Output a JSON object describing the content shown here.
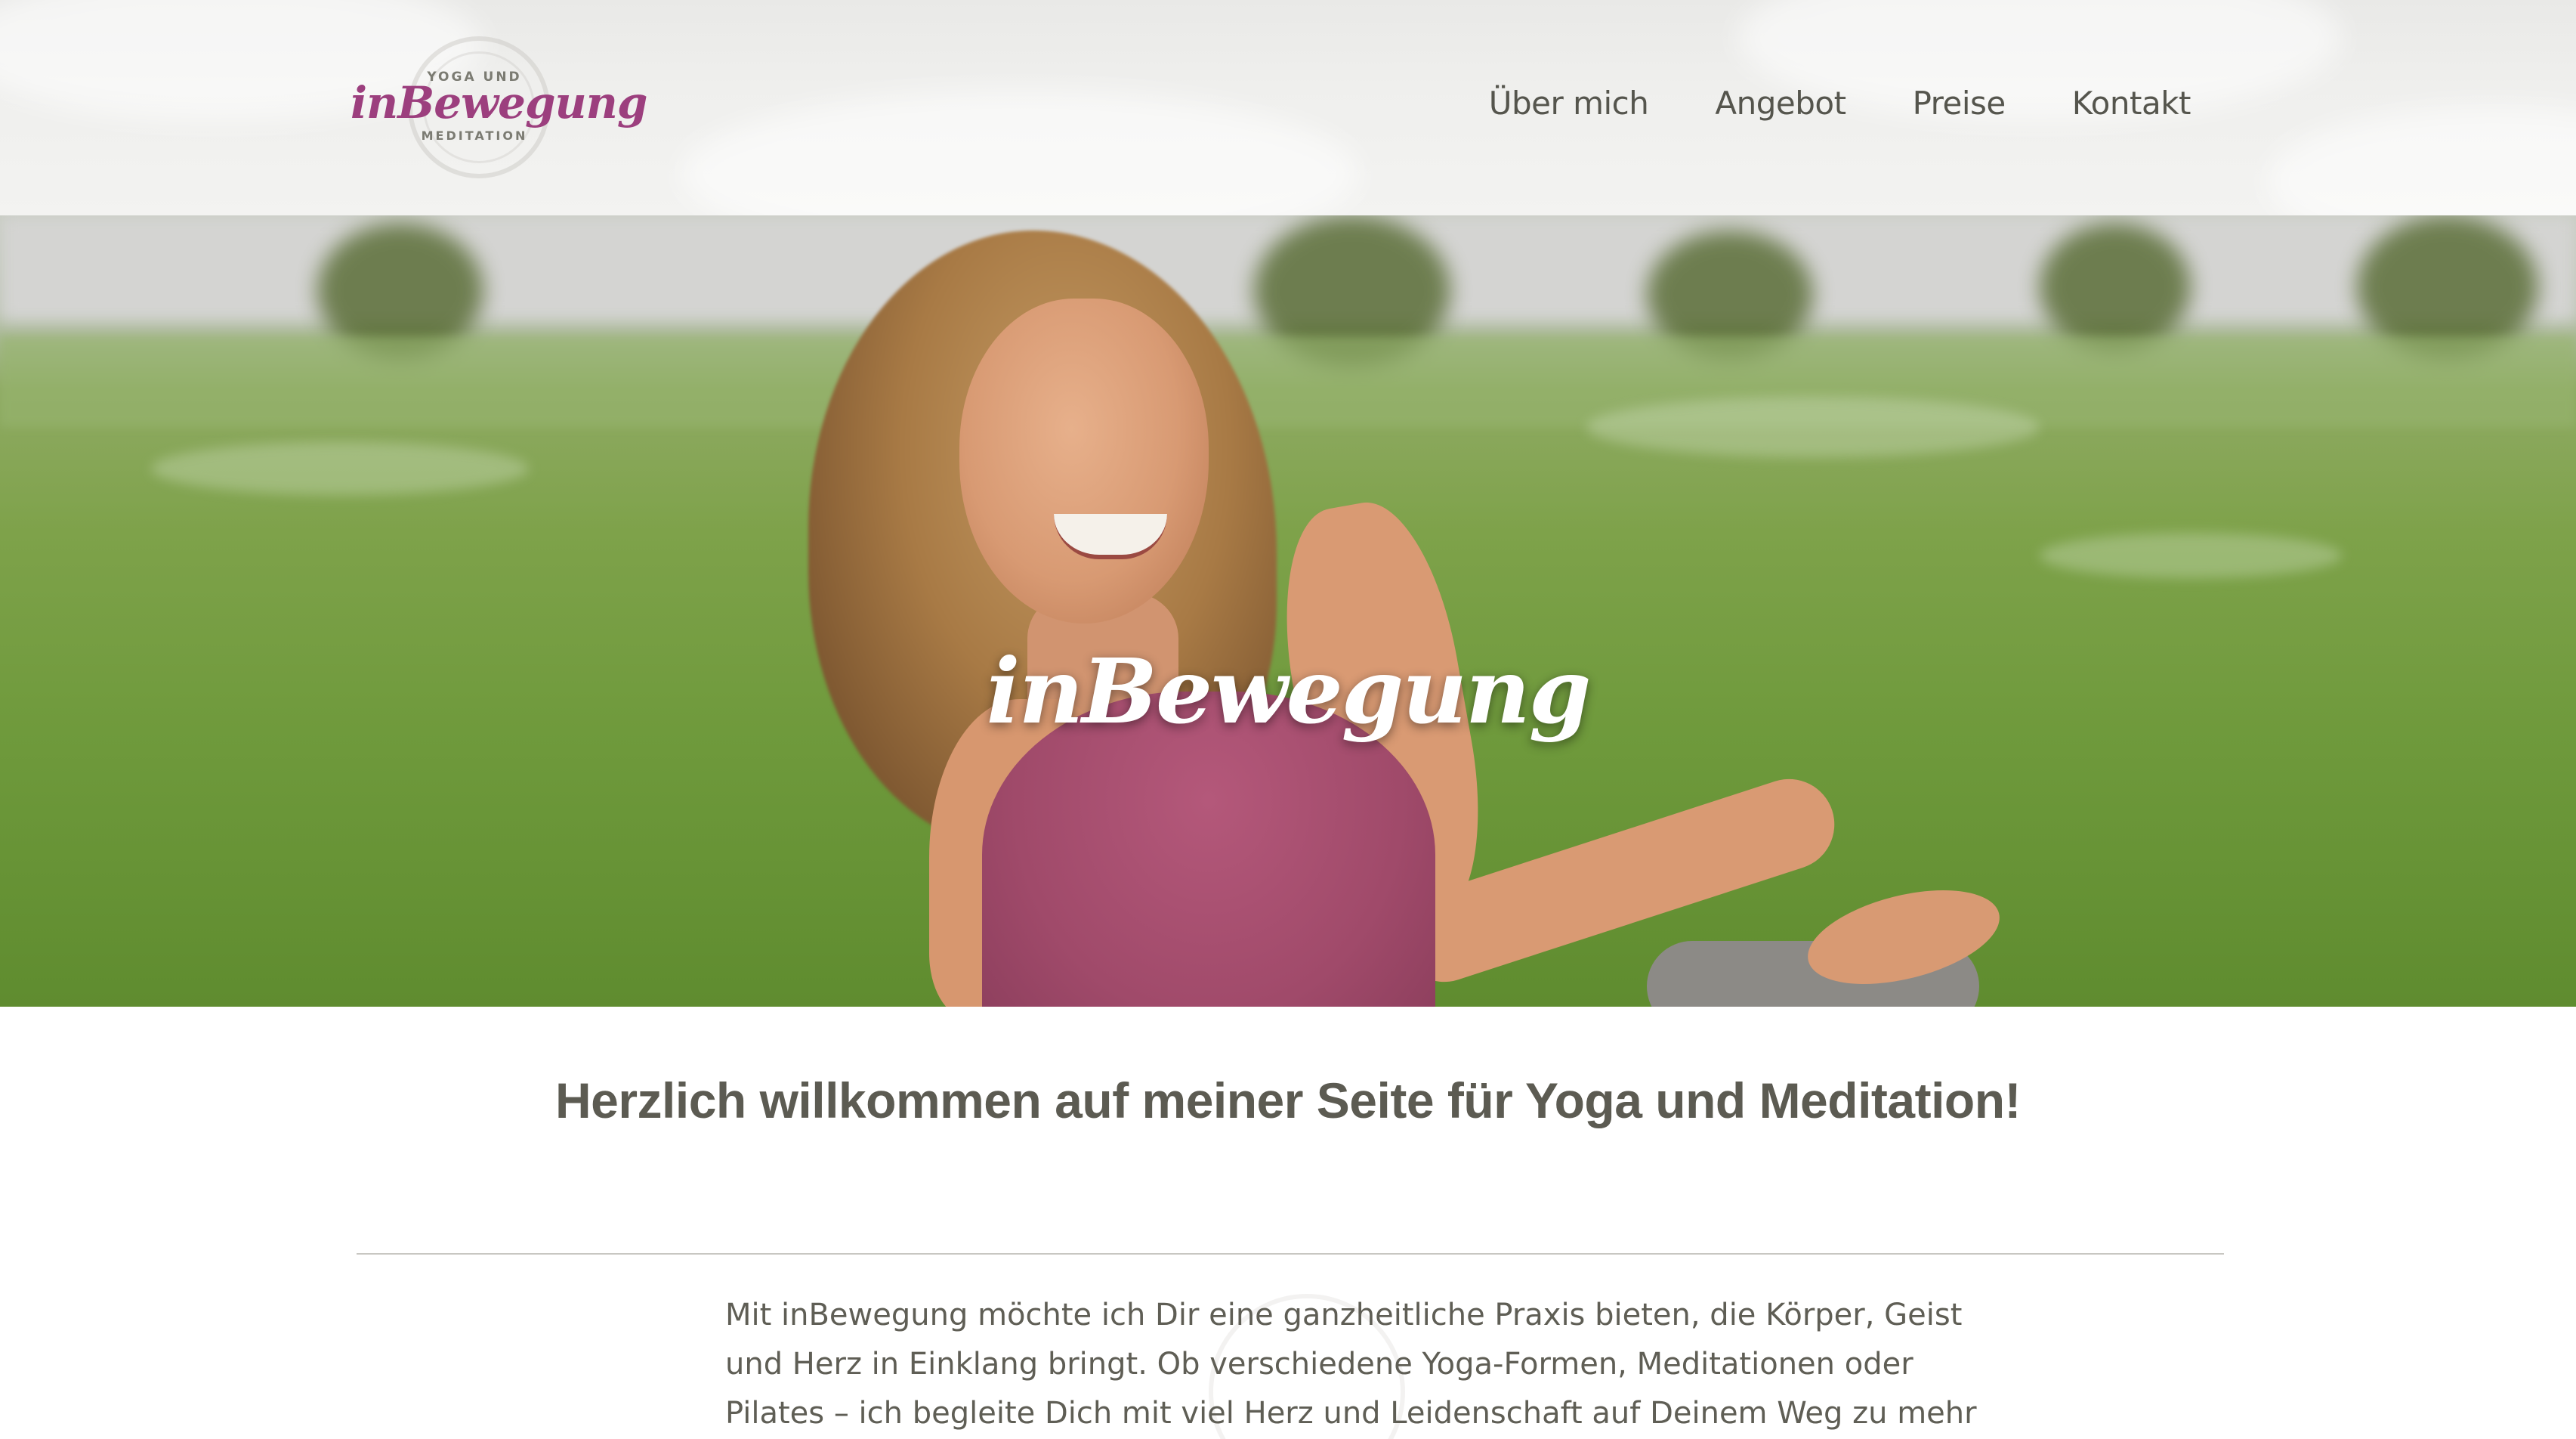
{
  "header": {
    "logo": {
      "top_text": "YOGA UND",
      "script_text": "inBewegung",
      "bottom_text": "MEDITATION"
    },
    "nav": [
      {
        "label": "Über mich"
      },
      {
        "label": "Angebot"
      },
      {
        "label": "Preise"
      },
      {
        "label": "Kontakt"
      }
    ]
  },
  "hero": {
    "title": "inBewegung"
  },
  "main": {
    "welcome_heading": "Herzlich willkommen auf meiner Seite für Yoga und Meditation!",
    "intro_lines": [
      "Mit inBewegung möchte ich Dir eine ganzheitliche Praxis bieten, die Körper, Geist",
      "und Herz in Einklang bringt. Ob verschiedene Yoga-Formen, Meditationen oder",
      "Pilates – ich begleite Dich mit viel Herz und Leidenschaft auf Deinem Weg zu mehr"
    ]
  },
  "colors": {
    "brand_purple": "#9c3f7e",
    "text_gray": "#5c5b52",
    "header_bg": "#efefed"
  }
}
